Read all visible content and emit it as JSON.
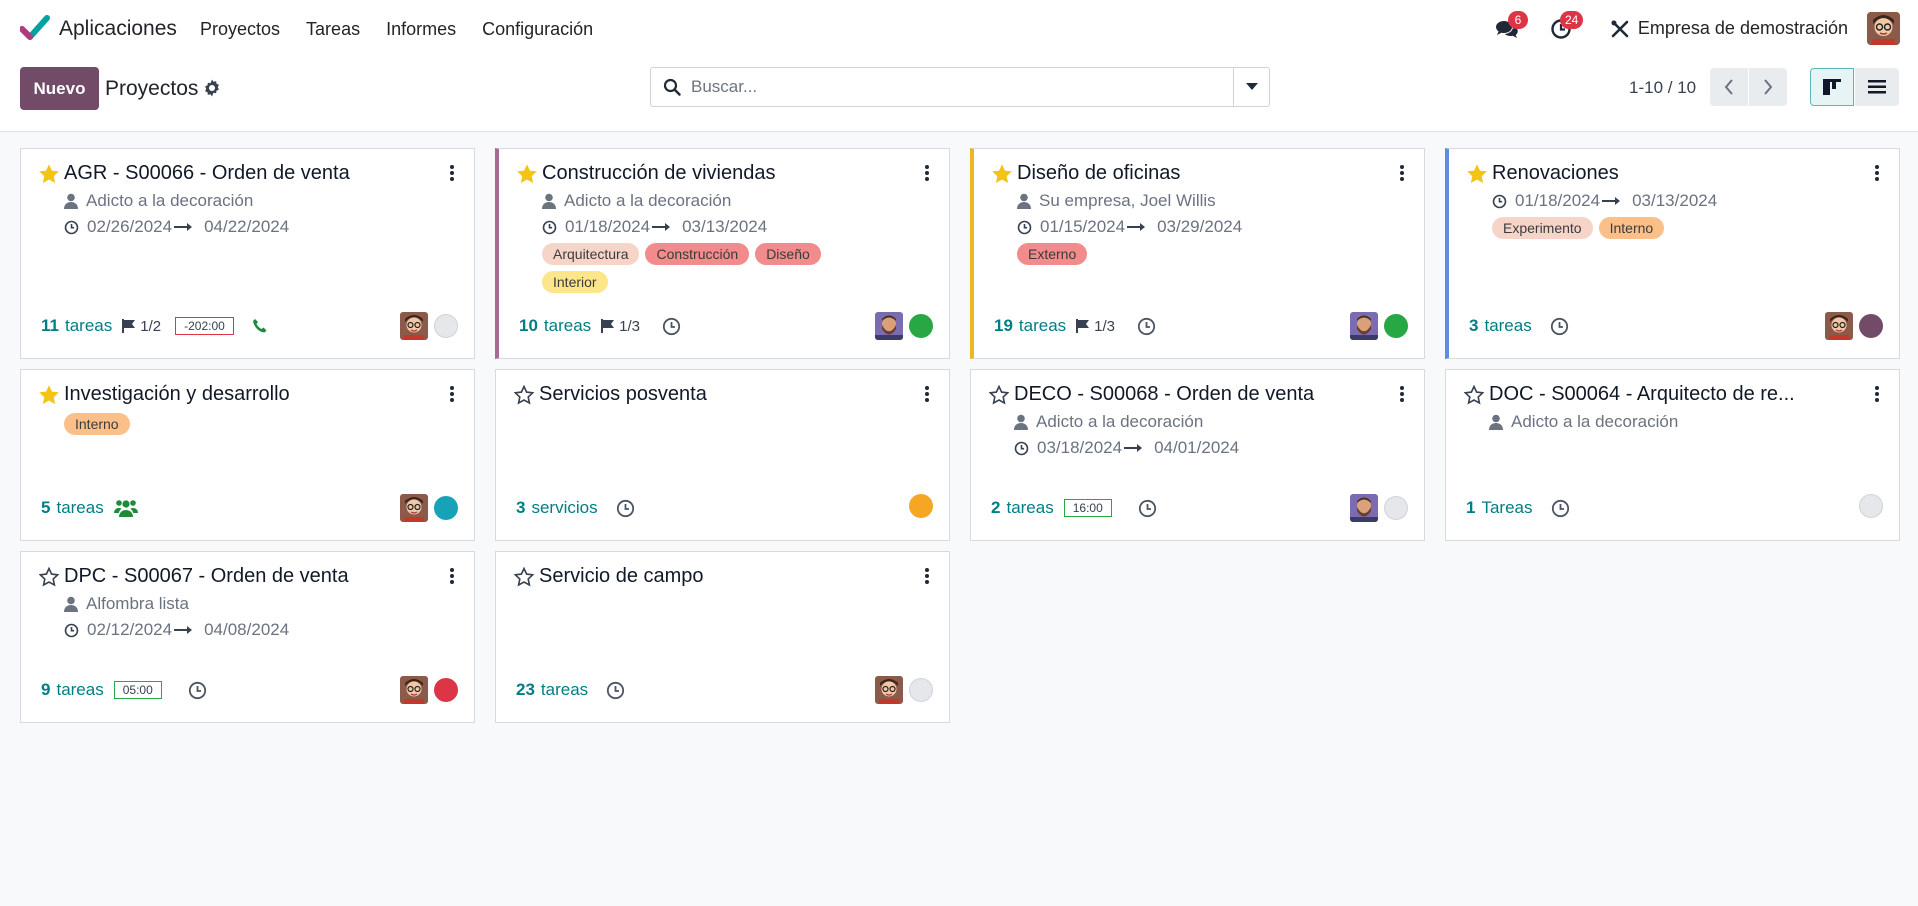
{
  "navbar": {
    "app_name": "Aplicaciones",
    "menu": [
      "Proyectos",
      "Tareas",
      "Informes",
      "Configuración"
    ],
    "messages_badge": "6",
    "activities_badge": "24",
    "company": "Empresa de demostración"
  },
  "control": {
    "new_label": "Nuevo",
    "breadcrumb": "Proyectos",
    "search_placeholder": "Buscar...",
    "pager": "1-10 / 10"
  },
  "colors": {
    "brand": "#714b67",
    "teal": "#017e84",
    "star": "#f3c316"
  },
  "projects": [
    {
      "title": "AGR - S00066 - Orden de venta",
      "starred": true,
      "customer": "Adicto a la decoración",
      "start": "02/26/2024",
      "end": "04/22/2024",
      "count": "11",
      "count_label": "tareas",
      "milestone": "1/2",
      "time": "-202:00",
      "time_status": "overdue",
      "status_color": "#e5e7eb"
    },
    {
      "title": "Construcción de viviendas",
      "starred": true,
      "customer": "Adicto a la decoración",
      "start": "01/18/2024",
      "end": "03/13/2024",
      "tags": [
        "Arquitectura",
        "Construcción",
        "Diseño",
        "Interior"
      ],
      "count": "10",
      "count_label": "tareas",
      "milestone": "1/3",
      "status_color": "#28a745",
      "accent": "#a46b95"
    },
    {
      "title": "Diseño de oficinas",
      "starred": true,
      "customer": "Su empresa, Joel Willis",
      "start": "01/15/2024",
      "end": "03/29/2024",
      "tags": [
        "Externo"
      ],
      "count": "19",
      "count_label": "tareas",
      "milestone": "1/3",
      "status_color": "#28a745",
      "accent": "#e8b923"
    },
    {
      "title": "Renovaciones",
      "starred": true,
      "start": "01/18/2024",
      "end": "03/13/2024",
      "tags": [
        "Experimento",
        "Interno"
      ],
      "count": "3",
      "count_label": "tareas",
      "status_color": "#714b67",
      "accent": "#5b8edb"
    },
    {
      "title": "Investigación y desarrollo",
      "starred": true,
      "tags": [
        "Interno"
      ],
      "count": "5",
      "count_label": "tareas",
      "status_color": "#17a2b8"
    },
    {
      "title": "Servicios posventa",
      "starred": false,
      "count": "3",
      "count_label": "servicios",
      "status_color": "#f5a623"
    },
    {
      "title": "DECO - S00068 - Orden de venta",
      "starred": false,
      "customer": "Adicto a la decoración",
      "start": "03/18/2024",
      "end": "04/01/2024",
      "count": "2",
      "count_label": "tareas",
      "time": "16:00",
      "time_status": "ok",
      "status_color": "#e5e7eb"
    },
    {
      "title": "DOC - S00064 - Arquitecto de re...",
      "starred": false,
      "customer": "Adicto a la decoración",
      "count": "1",
      "count_label": "Tareas",
      "status_color": "#e5e7eb"
    },
    {
      "title": "DPC - S00067 - Orden de venta",
      "starred": false,
      "customer": "Alfombra lista",
      "start": "02/12/2024",
      "end": "04/08/2024",
      "count": "9",
      "count_label": "tareas",
      "time": "05:00",
      "time_status": "ok",
      "status_color": "#dc3545"
    },
    {
      "title": "Servicio de campo",
      "starred": false,
      "count": "23",
      "count_label": "tareas",
      "status_color": "#e5e7eb"
    }
  ],
  "tag_colors": {
    "Arquitectura": "#f6d5c8",
    "Construcción": "#f28b8b",
    "Diseño": "#f28b8b",
    "Interior": "#fde68a",
    "Externo": "#f28b8b",
    "Experimento": "#f6d5c8",
    "Interno": "#fbc08a"
  }
}
